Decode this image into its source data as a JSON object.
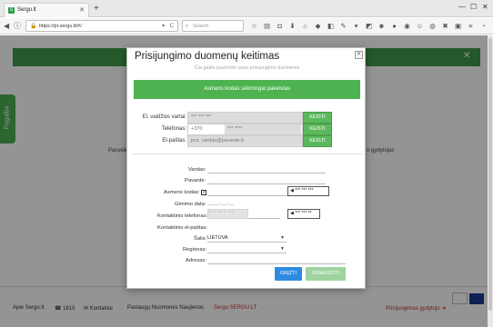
{
  "browser": {
    "tab_title": "Sergu.lt",
    "tab_favicon": "S",
    "url": "https://pr.sergu.lt/#/",
    "search_placeholder": "Search",
    "zoom_ctl": "C",
    "new_tab": "+"
  },
  "page": {
    "partial_left_text": "Pasveik",
    "partial_right_text": "o gydytojas",
    "side_tab_label": "Pagalba",
    "footer": {
      "about": "Apie Sergu.lt",
      "phone": "1815",
      "contacts": "Kontaktai",
      "terms": "Paslaugų Nuomonės Naujienos",
      "brand_link": "Sergu SERGU.LT",
      "doctor_login": "Prisijungimas gydytojo"
    }
  },
  "modal": {
    "title": "Prisijungimo duomenų keitimas",
    "close_label": "×",
    "subtitle": "Čia galite pasirinkti savo prisijungimo duomenis",
    "alert": "Asmens kodas sėkmingai pakeistas",
    "login_rows": [
      {
        "label": "El. valdžios vartai:",
        "value": "*** *** ***",
        "button": "KEISTI"
      },
      {
        "label": "Telefonas:",
        "prefix": "+370",
        "value": "*** ****",
        "button": "KEISTI"
      },
      {
        "label": "El-paštas:",
        "placeholder": "pvz. vardas@pavarde.lt",
        "button": "KEISTI"
      }
    ],
    "form": {
      "vardas_label": "Vardas:",
      "pavarde_label": "Pavardė:",
      "asmens_kodas_label": "Asmens kodas:",
      "asmens_kodas_checked": "✓",
      "asmens_kodas_bubble": "◀ *** *** ***",
      "gimimo_data_label": "Gimimo data:",
      "gimimo_data_value": "____-__-__",
      "kontaktinis_tel_label": "Kontaktinis telefonas:",
      "kontaktinis_tel_value": "*** *** **",
      "kontaktinis_tel_bubble": "◀ *** *** **",
      "kontaktinis_email_label": "Kontaktinis el-paštas:",
      "salis_label": "Šalis:",
      "salis_value": "LIETUVA",
      "regionas_label": "Regionas:",
      "adresas_label": "Adresas:"
    },
    "buttons": {
      "back": "GRĮŽTI",
      "save": "IŠSAUGOTI"
    }
  }
}
